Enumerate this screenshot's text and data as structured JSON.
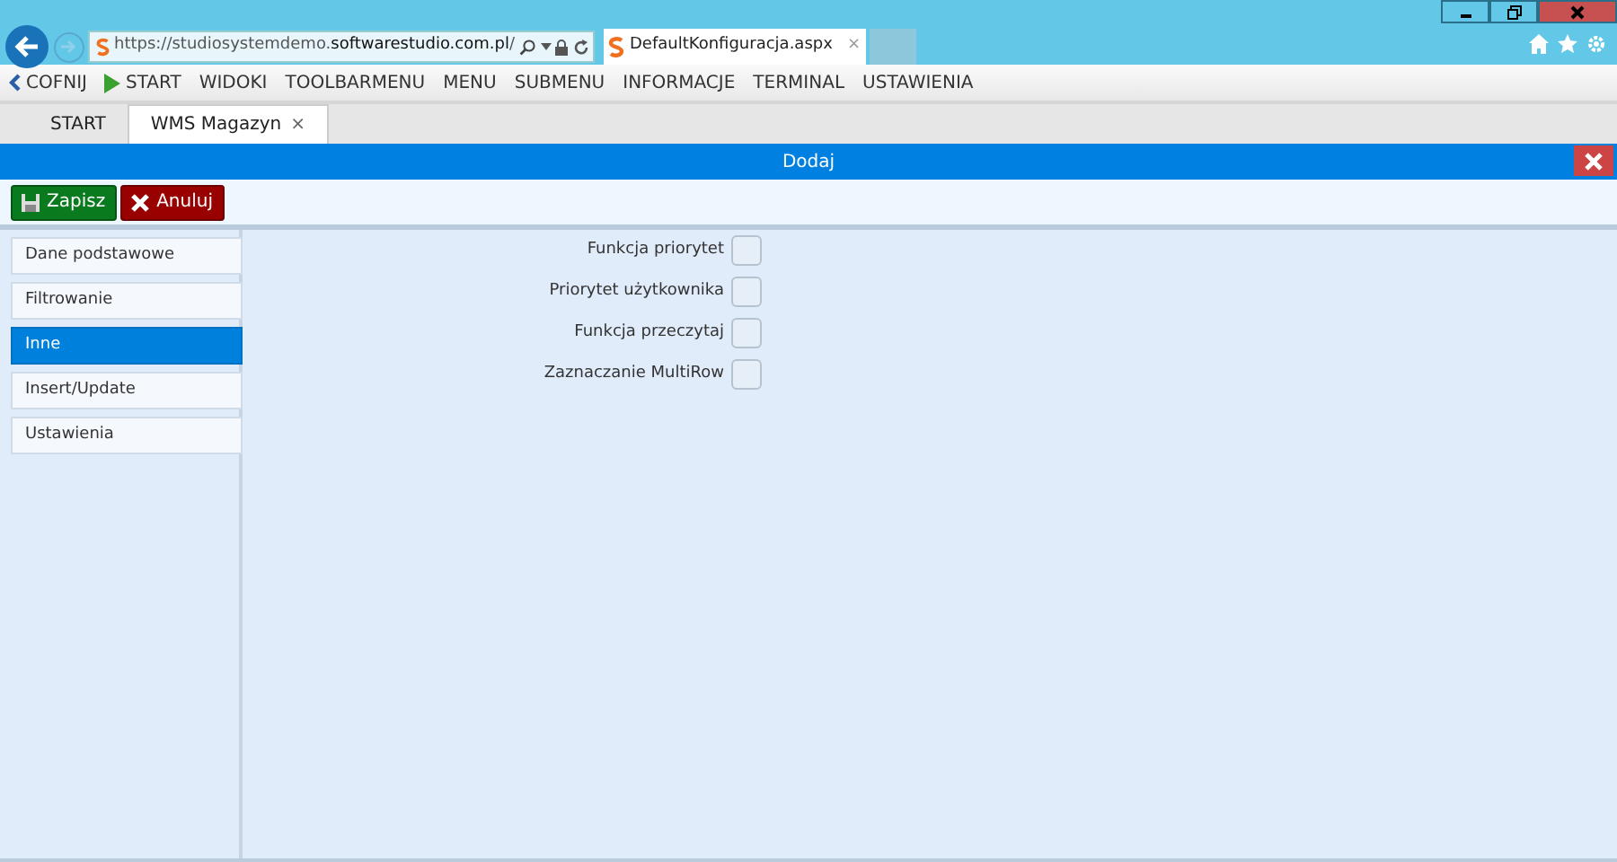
{
  "browser": {
    "url_prefix": "https://studiosystemdemo.",
    "url_domain": "softwarestudio.com.pl",
    "url_suffix": "/",
    "tab_title": "DefaultKonfiguracja.aspx",
    "tab_close": "×"
  },
  "menu": [
    {
      "label": "COFNIJ",
      "kind": "back"
    },
    {
      "label": "START",
      "kind": "play"
    },
    {
      "label": "WIDOKI",
      "kind": "text"
    },
    {
      "label": "TOOLBARMENU",
      "kind": "text"
    },
    {
      "label": "MENU",
      "kind": "text"
    },
    {
      "label": "SUBMENU",
      "kind": "text"
    },
    {
      "label": "INFORMACJE",
      "kind": "text"
    },
    {
      "label": "TERMINAL",
      "kind": "text"
    },
    {
      "label": "USTAWIENIA",
      "kind": "text"
    }
  ],
  "tabs": [
    {
      "label": "START",
      "selected": false
    },
    {
      "label": "WMS Magazyn",
      "selected": true,
      "close": "×"
    }
  ],
  "dialog": {
    "title": "Dodaj"
  },
  "buttons": [
    {
      "label": "Zapisz",
      "kind": "save"
    },
    {
      "label": "Anuluj",
      "kind": "cancel"
    }
  ],
  "sidebar": [
    {
      "label": "Dane podstawowe",
      "selected": false
    },
    {
      "label": "Filtrowanie",
      "selected": false
    },
    {
      "label": "Inne",
      "selected": true
    },
    {
      "label": "Insert/Update",
      "selected": false
    },
    {
      "label": "Ustawienia",
      "selected": false
    }
  ],
  "fields": [
    {
      "label": "Funkcja priorytet",
      "checked": false
    },
    {
      "label": "Priorytet użytkownika",
      "checked": false
    },
    {
      "label": "Funkcja przeczytaj",
      "checked": false
    },
    {
      "label": "Zaznaczanie MultiRow",
      "checked": false
    }
  ]
}
